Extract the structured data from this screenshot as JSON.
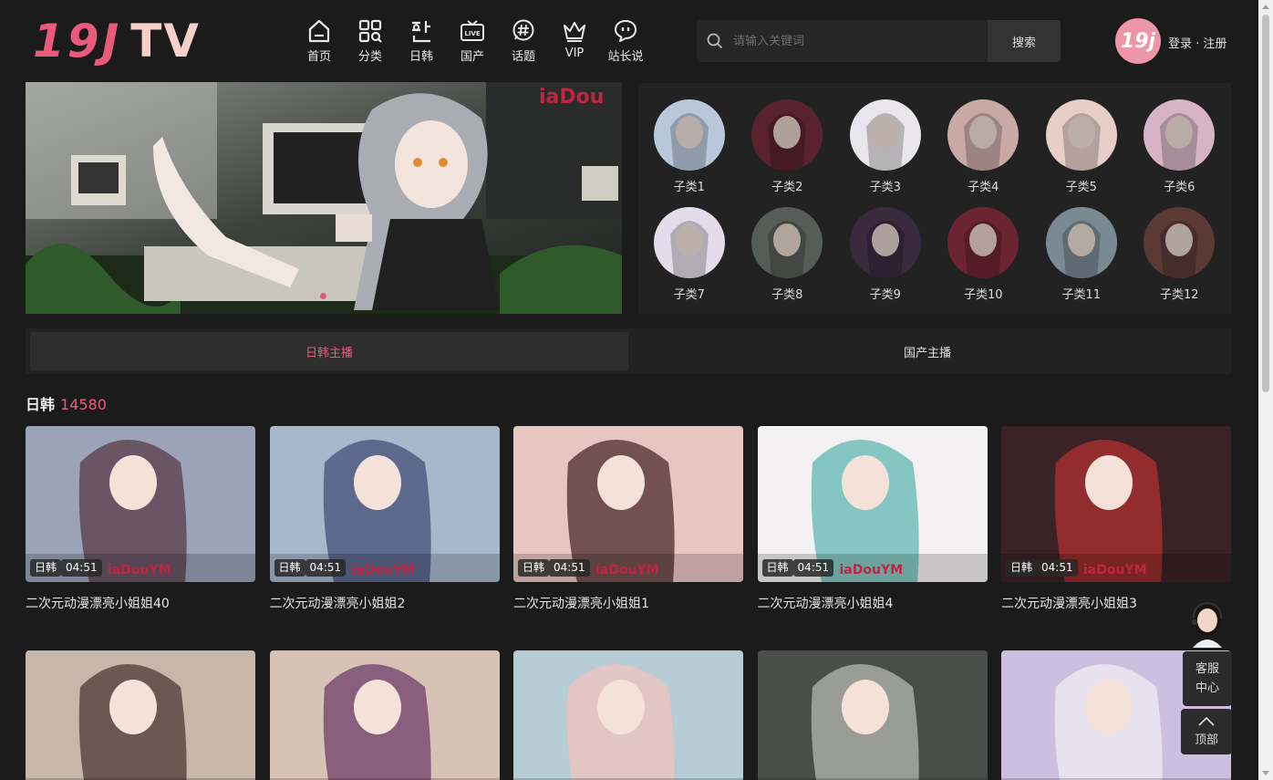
{
  "header": {
    "logo_main": "19J",
    "logo_sub": "TV",
    "nav": [
      {
        "label": "首页",
        "icon": "home-icon"
      },
      {
        "label": "分类",
        "icon": "grid-icon"
      },
      {
        "label": "日韩",
        "icon": "hangul-icon"
      },
      {
        "label": "国产",
        "icon": "live-tv-icon"
      },
      {
        "label": "话题",
        "icon": "hashtag-icon"
      },
      {
        "label": "VIP",
        "icon": "crown-icon"
      },
      {
        "label": "站长说",
        "icon": "chat-bubble-icon"
      }
    ],
    "search_placeholder": "请输入关键词",
    "search_button": "搜索",
    "avatar_text": "19j",
    "login_text": "登录 · 注册"
  },
  "banner": {
    "watermark": "iaDou"
  },
  "categories": [
    {
      "label": "子类1",
      "color": "#b9c7db"
    },
    {
      "label": "子类2",
      "color": "#5a2230"
    },
    {
      "label": "子类3",
      "color": "#e8e6ea"
    },
    {
      "label": "子类4",
      "color": "#c9a9a4"
    },
    {
      "label": "子类5",
      "color": "#e7cfc8"
    },
    {
      "label": "子类6",
      "color": "#d7b4c4"
    },
    {
      "label": "子类7",
      "color": "#e4dcea"
    },
    {
      "label": "子类8",
      "color": "#565c58"
    },
    {
      "label": "子类9",
      "color": "#3a2a3e"
    },
    {
      "label": "子类10",
      "color": "#6b2532"
    },
    {
      "label": "子类11",
      "color": "#7a8a93"
    },
    {
      "label": "子类12",
      "color": "#5b3a35"
    }
  ],
  "tabs": [
    {
      "label": "日韩主播",
      "active": true
    },
    {
      "label": "国产主播",
      "active": false
    }
  ],
  "section": {
    "title": "日韩",
    "count": "14580"
  },
  "videos_row1": [
    {
      "category": "日韩",
      "duration": "04:51",
      "title": "二次元动漫漂亮小姐姐40",
      "watermark": "iaDouYM",
      "bg": "#9aa3b8",
      "accent": "#5a3b4a"
    },
    {
      "category": "日韩",
      "duration": "04:51",
      "title": "二次元动漫漂亮小姐姐2",
      "watermark": "iaDouYM",
      "bg": "#a8b8cc",
      "accent": "#44507a"
    },
    {
      "category": "日韩",
      "duration": "04:51",
      "title": "二次元动漫漂亮小姐姐1",
      "watermark": "iaDouYM",
      "bg": "#e9c5c2",
      "accent": "#4a2a2a"
    },
    {
      "category": "日韩",
      "duration": "04:51",
      "title": "二次元动漫漂亮小姐姐4",
      "watermark": "iaDouYM",
      "bg": "#f3f1f2",
      "accent": "#5fb8b2"
    },
    {
      "category": "日韩",
      "duration": "04:51",
      "title": "二次元动漫漂亮小姐姐3",
      "watermark": "iaDouYM",
      "bg": "#3a2226",
      "accent": "#b2302f"
    }
  ],
  "videos_row2": [
    {
      "bg": "#c7b6aa",
      "accent": "#4b3a32"
    },
    {
      "bg": "#d8c2b6",
      "accent": "#6d3f6a"
    },
    {
      "bg": "#b7cdd6",
      "accent": "#efc3bd"
    },
    {
      "bg": "#4a4e4a",
      "accent": "#b5b8b2"
    },
    {
      "bg": "#cdbfe0",
      "accent": "#f0eef3"
    }
  ],
  "support": {
    "label_line1": "客服",
    "label_line2": "中心",
    "top_label": "顶部"
  },
  "colors": {
    "brand": "#ea5a7d",
    "logo_secondary": "#f6cfc8",
    "bg": "#1b1b1c",
    "panel": "#222223"
  }
}
